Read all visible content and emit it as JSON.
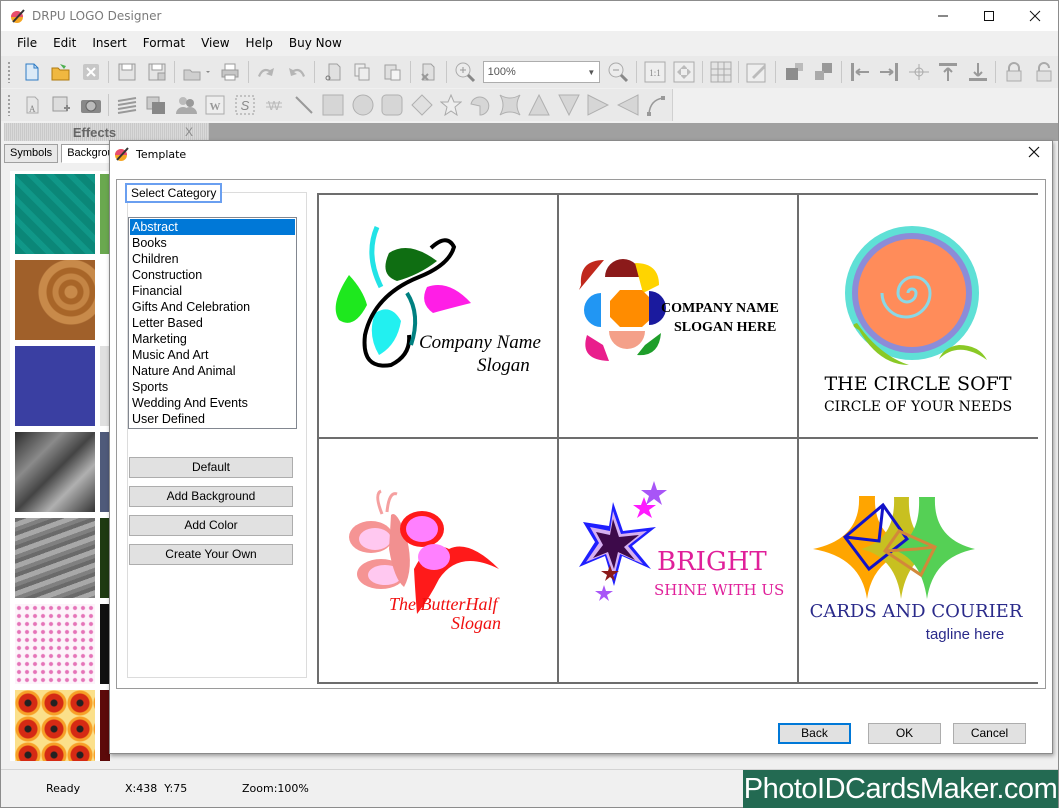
{
  "window": {
    "title": "DRPU LOGO Designer",
    "controls": {
      "minimize": "—",
      "maximize": "☐",
      "close": "✕"
    }
  },
  "menu": [
    "File",
    "Edit",
    "Insert",
    "Format",
    "View",
    "Help",
    "Buy Now"
  ],
  "toolbar1": {
    "zoom_value": "100%",
    "buttons": [
      "new-file",
      "open-folder",
      "close-file",
      "save",
      "save-as",
      "export",
      "print",
      "undo",
      "redo",
      "cut",
      "copy",
      "paste",
      "delete",
      "zoom-in",
      "zoom-out",
      "actual-size",
      "fit-to-window",
      "grid",
      "edit",
      "bring-forward",
      "send-backward",
      "align-left",
      "align-right",
      "align-center",
      "align-top",
      "align-bottom",
      "lock",
      "unlock"
    ]
  },
  "toolbar2": {
    "buttons": [
      "text",
      "image",
      "camera",
      "layers",
      "bring-to-front",
      "users",
      "word-art",
      "signature",
      "watermark",
      "line",
      "rectangle",
      "ellipse",
      "rounded-rectangle",
      "diamond",
      "star",
      "arc",
      "star4",
      "triangle-up",
      "triangle-down",
      "triangle-right",
      "triangle-left",
      "curve"
    ]
  },
  "effects_panel": {
    "header": "Effects",
    "close": "X",
    "tabs": [
      "Symbols",
      "Backgrou"
    ],
    "active_tab": "Backgrou"
  },
  "dialog": {
    "title": "Template",
    "close": "✕",
    "category_legend": "Select Category",
    "categories": [
      "Abstract",
      "Books",
      "Children",
      "Construction",
      "Financial",
      "Gifts And Celebration",
      "Letter Based",
      "Marketing",
      "Music And Art",
      "Nature And Animal",
      "Sports",
      "Wedding And Events",
      "User Defined"
    ],
    "selected_category": "Abstract",
    "side_buttons": [
      "Default",
      "Add Background",
      "Add Color",
      "Create Your Own"
    ],
    "templates": [
      {
        "name": "leaves",
        "line1": "Company Name",
        "line2": "Slogan"
      },
      {
        "name": "octagon",
        "line1": "COMPANY NAME",
        "line2": "SLOGAN HERE"
      },
      {
        "name": "circle-soft",
        "line1": "THE CIRCLE SOFT",
        "line2": "CIRCLE OF YOUR NEEDS"
      },
      {
        "name": "butterfly",
        "line1": "The ButterHalf",
        "line2": "Slogan"
      },
      {
        "name": "bright",
        "line1": "BRIGHT",
        "line2": "SHINE WITH US"
      },
      {
        "name": "cards-courier",
        "line1": "CARDS AND COURIER",
        "line2": "tagline here"
      }
    ],
    "footer_buttons": {
      "back": "Back",
      "ok": "OK",
      "cancel": "Cancel"
    }
  },
  "status": {
    "state": "Ready",
    "coords": "X:438  Y:75",
    "zoom": "Zoom:100%"
  },
  "watermark": "PhotoIDCardsMaker.com",
  "colors": {
    "selection": "#0078d7",
    "brand_bg": "#236a52",
    "focus_border": "#0078d7"
  }
}
